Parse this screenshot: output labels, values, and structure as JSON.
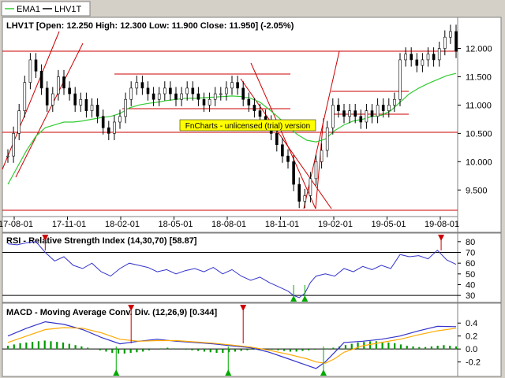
{
  "legend": {
    "items": [
      {
        "label": "EMA1",
        "color": "#33cc33"
      },
      {
        "label": "LHV1T",
        "color": "#000000"
      }
    ]
  },
  "watermark": "FnCharts - unlicensed (trial) version",
  "chart_data": [
    {
      "type": "candlestick",
      "title": "LHV1T [Open: 12.250  High: 12.300  Low: 11.900  Close: 11.950] (-2.05%)",
      "ylim": [
        9.1,
        12.3
      ],
      "yticks": [
        {
          "v": 12.0,
          "label": "12.000"
        },
        {
          "v": 11.5,
          "label": "11.500"
        },
        {
          "v": 11.0,
          "label": "11.000"
        },
        {
          "v": 10.5,
          "label": "10.500"
        },
        {
          "v": 10.0,
          "label": "10.000"
        },
        {
          "v": 9.5,
          "label": "9.500"
        }
      ],
      "xticks": [
        "17-08-01",
        "17-11-01",
        "18-02-01",
        "18-05-01",
        "18-08-01",
        "18-11-01",
        "19-02-01",
        "19-05-01",
        "19-08-01"
      ],
      "price_series": {
        "name": "LHV1T",
        "points": [
          [
            0,
            10.1
          ],
          [
            6,
            10.5
          ],
          [
            12,
            10.9
          ],
          [
            18,
            11.4
          ],
          [
            24,
            11.8
          ],
          [
            30,
            11.6
          ],
          [
            36,
            11.3
          ],
          [
            42,
            11.0
          ],
          [
            48,
            11.2
          ],
          [
            54,
            11.5
          ],
          [
            60,
            11.3
          ],
          [
            66,
            11.2
          ],
          [
            72,
            11.0
          ],
          [
            78,
            11.1
          ],
          [
            84,
            10.9
          ],
          [
            90,
            11.0
          ],
          [
            96,
            10.8
          ],
          [
            102,
            10.6
          ],
          [
            108,
            10.5
          ],
          [
            114,
            10.7
          ],
          [
            120,
            10.8
          ],
          [
            126,
            11.1
          ],
          [
            132,
            11.3
          ],
          [
            138,
            11.4
          ],
          [
            144,
            11.3
          ],
          [
            150,
            11.2
          ],
          [
            156,
            11.1
          ],
          [
            162,
            11.2
          ],
          [
            168,
            11.3
          ],
          [
            174,
            11.2
          ],
          [
            180,
            11.1
          ],
          [
            186,
            11.2
          ],
          [
            192,
            11.3
          ],
          [
            198,
            11.2
          ],
          [
            204,
            11.1
          ],
          [
            210,
            11.0
          ],
          [
            216,
            11.1
          ],
          [
            222,
            11.2
          ],
          [
            228,
            11.2
          ],
          [
            234,
            11.3
          ],
          [
            240,
            11.4
          ],
          [
            246,
            11.3
          ],
          [
            252,
            11.1
          ],
          [
            258,
            11.0
          ],
          [
            264,
            10.9
          ],
          [
            270,
            10.8
          ],
          [
            276,
            10.7
          ],
          [
            282,
            10.5
          ],
          [
            288,
            10.3
          ],
          [
            294,
            10.1
          ],
          [
            300,
            10.0
          ],
          [
            306,
            9.6
          ],
          [
            312,
            9.3
          ],
          [
            318,
            9.4
          ],
          [
            324,
            9.7
          ],
          [
            330,
            10.0
          ],
          [
            336,
            10.2
          ],
          [
            342,
            10.6
          ],
          [
            348,
            11.0
          ],
          [
            354,
            10.9
          ],
          [
            360,
            10.8
          ],
          [
            366,
            10.9
          ],
          [
            372,
            10.8
          ],
          [
            378,
            10.7
          ],
          [
            384,
            10.9
          ],
          [
            390,
            10.8
          ],
          [
            396,
            11.0
          ],
          [
            402,
            10.9
          ],
          [
            408,
            11.0
          ],
          [
            414,
            11.1
          ],
          [
            420,
            11.8
          ],
          [
            426,
            11.9
          ],
          [
            432,
            11.8
          ],
          [
            438,
            11.7
          ],
          [
            444,
            11.8
          ],
          [
            450,
            11.9
          ],
          [
            456,
            11.8
          ],
          [
            462,
            12.0
          ],
          [
            468,
            12.2
          ],
          [
            474,
            12.3
          ],
          [
            480,
            11.95
          ]
        ]
      },
      "ema_series": {
        "name": "EMA1",
        "points": [
          [
            0,
            9.6
          ],
          [
            10,
            9.9
          ],
          [
            20,
            10.2
          ],
          [
            30,
            10.45
          ],
          [
            40,
            10.6
          ],
          [
            50,
            10.65
          ],
          [
            60,
            10.7
          ],
          [
            70,
            10.7
          ],
          [
            80,
            10.72
          ],
          [
            90,
            10.75
          ],
          [
            100,
            10.78
          ],
          [
            110,
            10.8
          ],
          [
            120,
            10.85
          ],
          [
            130,
            10.95
          ],
          [
            140,
            11.0
          ],
          [
            150,
            11.03
          ],
          [
            160,
            11.05
          ],
          [
            170,
            11.08
          ],
          [
            180,
            11.1
          ],
          [
            190,
            11.12
          ],
          [
            200,
            11.12
          ],
          [
            210,
            11.13
          ],
          [
            220,
            11.14
          ],
          [
            230,
            11.15
          ],
          [
            240,
            11.16
          ],
          [
            250,
            11.15
          ],
          [
            260,
            11.12
          ],
          [
            270,
            11.05
          ],
          [
            280,
            10.92
          ],
          [
            290,
            10.78
          ],
          [
            300,
            10.62
          ],
          [
            310,
            10.48
          ],
          [
            320,
            10.38
          ],
          [
            330,
            10.35
          ],
          [
            340,
            10.4
          ],
          [
            350,
            10.55
          ],
          [
            360,
            10.65
          ],
          [
            370,
            10.72
          ],
          [
            380,
            10.75
          ],
          [
            390,
            10.8
          ],
          [
            400,
            10.82
          ],
          [
            410,
            10.9
          ],
          [
            420,
            11.05
          ],
          [
            430,
            11.2
          ],
          [
            440,
            11.3
          ],
          [
            450,
            11.38
          ],
          [
            460,
            11.45
          ],
          [
            470,
            11.52
          ],
          [
            480,
            11.56
          ]
        ]
      }
    },
    {
      "type": "line",
      "title": "RSI - Relative Strength Index (14,30,70) [58.87]",
      "ylim": [
        25,
        85
      ],
      "yticks": [
        80,
        70,
        60,
        50,
        40,
        30
      ],
      "reference_levels": [
        30,
        70
      ],
      "series": [
        {
          "name": "RSI",
          "color": "#3333cc",
          "points": [
            [
              0,
              78
            ],
            [
              10,
              77
            ],
            [
              20,
              79
            ],
            [
              30,
              80
            ],
            [
              40,
              70
            ],
            [
              50,
              62
            ],
            [
              60,
              66
            ],
            [
              70,
              58
            ],
            [
              80,
              55
            ],
            [
              90,
              60
            ],
            [
              100,
              52
            ],
            [
              110,
              48
            ],
            [
              120,
              55
            ],
            [
              130,
              60
            ],
            [
              140,
              58
            ],
            [
              150,
              56
            ],
            [
              160,
              52
            ],
            [
              170,
              54
            ],
            [
              180,
              50
            ],
            [
              190,
              53
            ],
            [
              200,
              55
            ],
            [
              210,
              52
            ],
            [
              220,
              56
            ],
            [
              230,
              50
            ],
            [
              240,
              54
            ],
            [
              250,
              48
            ],
            [
              260,
              44
            ],
            [
              270,
              47
            ],
            [
              280,
              42
            ],
            [
              290,
              38
            ],
            [
              300,
              34
            ],
            [
              306,
              30
            ],
            [
              312,
              28
            ],
            [
              318,
              32
            ],
            [
              324,
              42
            ],
            [
              330,
              48
            ],
            [
              340,
              50
            ],
            [
              350,
              48
            ],
            [
              360,
              55
            ],
            [
              370,
              52
            ],
            [
              380,
              57
            ],
            [
              390,
              54
            ],
            [
              400,
              58
            ],
            [
              410,
              55
            ],
            [
              420,
              68
            ],
            [
              430,
              66
            ],
            [
              440,
              67
            ],
            [
              450,
              64
            ],
            [
              460,
              72
            ],
            [
              470,
              63
            ],
            [
              480,
              58.87
            ]
          ]
        }
      ],
      "markers": [
        {
          "x": 40,
          "type": "sell"
        },
        {
          "x": 306,
          "type": "buy"
        },
        {
          "x": 318,
          "type": "buy"
        },
        {
          "x": 464,
          "type": "sell"
        }
      ]
    },
    {
      "type": "bar",
      "title": "MACD - Moving Average Conv. Div. (12,26,9) [0.344]",
      "ylim": [
        -0.35,
        0.5
      ],
      "yticks": [
        {
          "v": 0.4,
          "label": "0.4"
        },
        {
          "v": 0.2,
          "label": "0.2"
        },
        {
          "v": 0.0,
          "label": "0.0"
        },
        {
          "v": -0.2,
          "label": "-0.2"
        }
      ],
      "series": [
        {
          "name": "MACD",
          "color": "#3333cc",
          "points": [
            [
              0,
              0.2
            ],
            [
              20,
              0.32
            ],
            [
              40,
              0.42
            ],
            [
              60,
              0.38
            ],
            [
              80,
              0.3
            ],
            [
              100,
              0.18
            ],
            [
              120,
              0.08
            ],
            [
              140,
              0.12
            ],
            [
              160,
              0.15
            ],
            [
              180,
              0.12
            ],
            [
              200,
              0.1
            ],
            [
              220,
              0.08
            ],
            [
              240,
              0.05
            ],
            [
              260,
              0.02
            ],
            [
              280,
              -0.05
            ],
            [
              300,
              -0.15
            ],
            [
              320,
              -0.25
            ],
            [
              330,
              -0.3
            ],
            [
              340,
              -0.2
            ],
            [
              350,
              -0.05
            ],
            [
              360,
              0.1
            ],
            [
              380,
              0.12
            ],
            [
              400,
              0.15
            ],
            [
              420,
              0.2
            ],
            [
              440,
              0.28
            ],
            [
              460,
              0.35
            ],
            [
              480,
              0.344
            ]
          ]
        },
        {
          "name": "Signal",
          "color": "#ffaa00",
          "points": [
            [
              0,
              0.1
            ],
            [
              20,
              0.2
            ],
            [
              40,
              0.3
            ],
            [
              60,
              0.33
            ],
            [
              80,
              0.32
            ],
            [
              100,
              0.25
            ],
            [
              120,
              0.15
            ],
            [
              140,
              0.12
            ],
            [
              160,
              0.13
            ],
            [
              180,
              0.13
            ],
            [
              200,
              0.11
            ],
            [
              220,
              0.09
            ],
            [
              240,
              0.06
            ],
            [
              260,
              0.03
            ],
            [
              280,
              -0.02
            ],
            [
              300,
              -0.08
            ],
            [
              320,
              -0.15
            ],
            [
              330,
              -0.2
            ],
            [
              340,
              -0.22
            ],
            [
              350,
              -0.15
            ],
            [
              360,
              -0.05
            ],
            [
              380,
              0.05
            ],
            [
              400,
              0.1
            ],
            [
              420,
              0.15
            ],
            [
              440,
              0.22
            ],
            [
              460,
              0.28
            ],
            [
              480,
              0.32
            ]
          ]
        }
      ],
      "histogram": [
        0.05,
        0.07,
        0.09,
        0.1,
        0.11,
        0.12,
        0.13,
        0.12,
        0.11,
        0.1,
        0.08,
        0.06,
        0.04,
        0.02,
        0.0,
        -0.02,
        -0.04,
        -0.06,
        -0.07,
        -0.07,
        -0.06,
        -0.05,
        -0.04,
        -0.02,
        0.0,
        0.01,
        0.02,
        0.01,
        0.0,
        -0.01,
        -0.02,
        -0.03,
        -0.04,
        -0.05,
        -0.06,
        -0.06,
        -0.05,
        -0.04,
        -0.03,
        -0.02,
        -0.01,
        0.0,
        0.0,
        -0.01,
        -0.02,
        -0.03,
        -0.04,
        -0.04,
        -0.03,
        -0.02,
        -0.01,
        0.0,
        0.01,
        0.02,
        0.04,
        0.06,
        0.08,
        0.1,
        0.11,
        0.12,
        0.12,
        0.11,
        0.1,
        0.09,
        0.07,
        0.05,
        0.04,
        0.03,
        0.03,
        0.04,
        0.05,
        0.06,
        0.05,
        0.04
      ],
      "markers": [
        {
          "x": 116,
          "type": "buy"
        },
        {
          "x": 132,
          "type": "sell"
        },
        {
          "x": 236,
          "type": "buy"
        },
        {
          "x": 252,
          "type": "sell"
        },
        {
          "x": 338,
          "type": "buy"
        }
      ]
    }
  ]
}
